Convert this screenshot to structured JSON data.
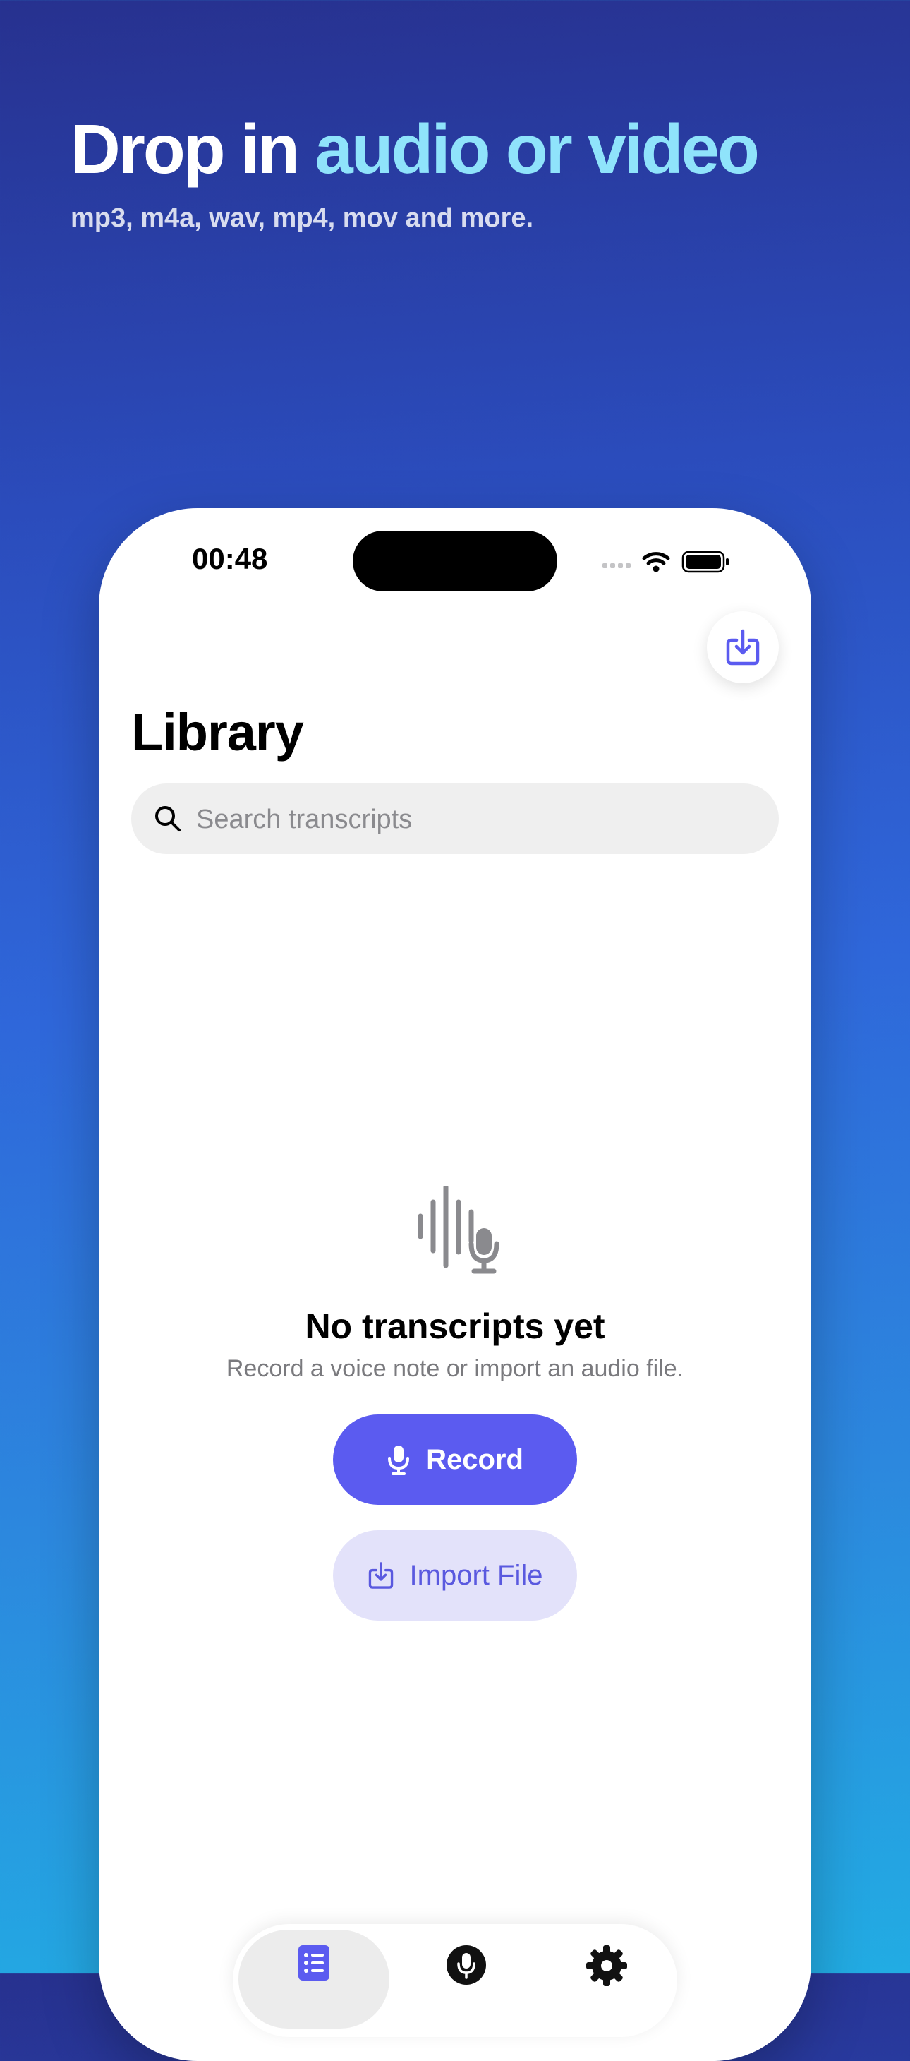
{
  "headline": {
    "lead": "Drop in ",
    "accent": "audio or video",
    "subtitle": "mp3, m4a, wav, mp4, mov and more."
  },
  "status_bar": {
    "time": "00:48"
  },
  "library": {
    "title": "Library",
    "search_placeholder": "Search transcripts",
    "empty_title": "No transcripts yet",
    "empty_subtitle": "Record a voice note or import an audio file.",
    "record_label": "Record",
    "import_label": "Import File"
  },
  "icons": {
    "fab": "import-icon",
    "search": "search-icon",
    "empty": "waveform-mic-icon",
    "record": "mic-icon",
    "import": "import-icon",
    "tabs": [
      "list-icon",
      "mic-icon",
      "gear-icon"
    ]
  },
  "colors": {
    "accent": "#5b5bf0",
    "accent_soft": "#e3e2fa",
    "headline_accent": "#8fe3fb"
  }
}
